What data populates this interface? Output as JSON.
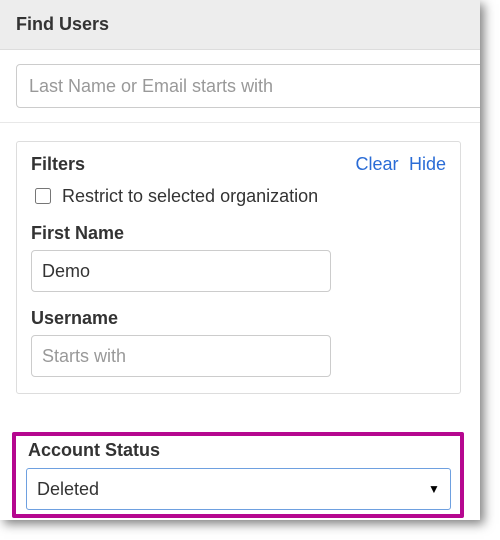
{
  "header": {
    "title": "Find Users"
  },
  "search": {
    "placeholder": "Last Name or Email starts with",
    "value": ""
  },
  "filters": {
    "title": "Filters",
    "clear_label": "Clear",
    "hide_label": "Hide",
    "restrict_label": "Restrict to selected organization",
    "restrict_checked": false,
    "first_name": {
      "label": "First Name",
      "value": "Demo",
      "placeholder": ""
    },
    "username": {
      "label": "Username",
      "value": "",
      "placeholder": "Starts with"
    },
    "account_status": {
      "label": "Account Status",
      "selected": "Deleted"
    }
  },
  "colors": {
    "highlight": "#b5078f",
    "link": "#2a6cd6"
  }
}
